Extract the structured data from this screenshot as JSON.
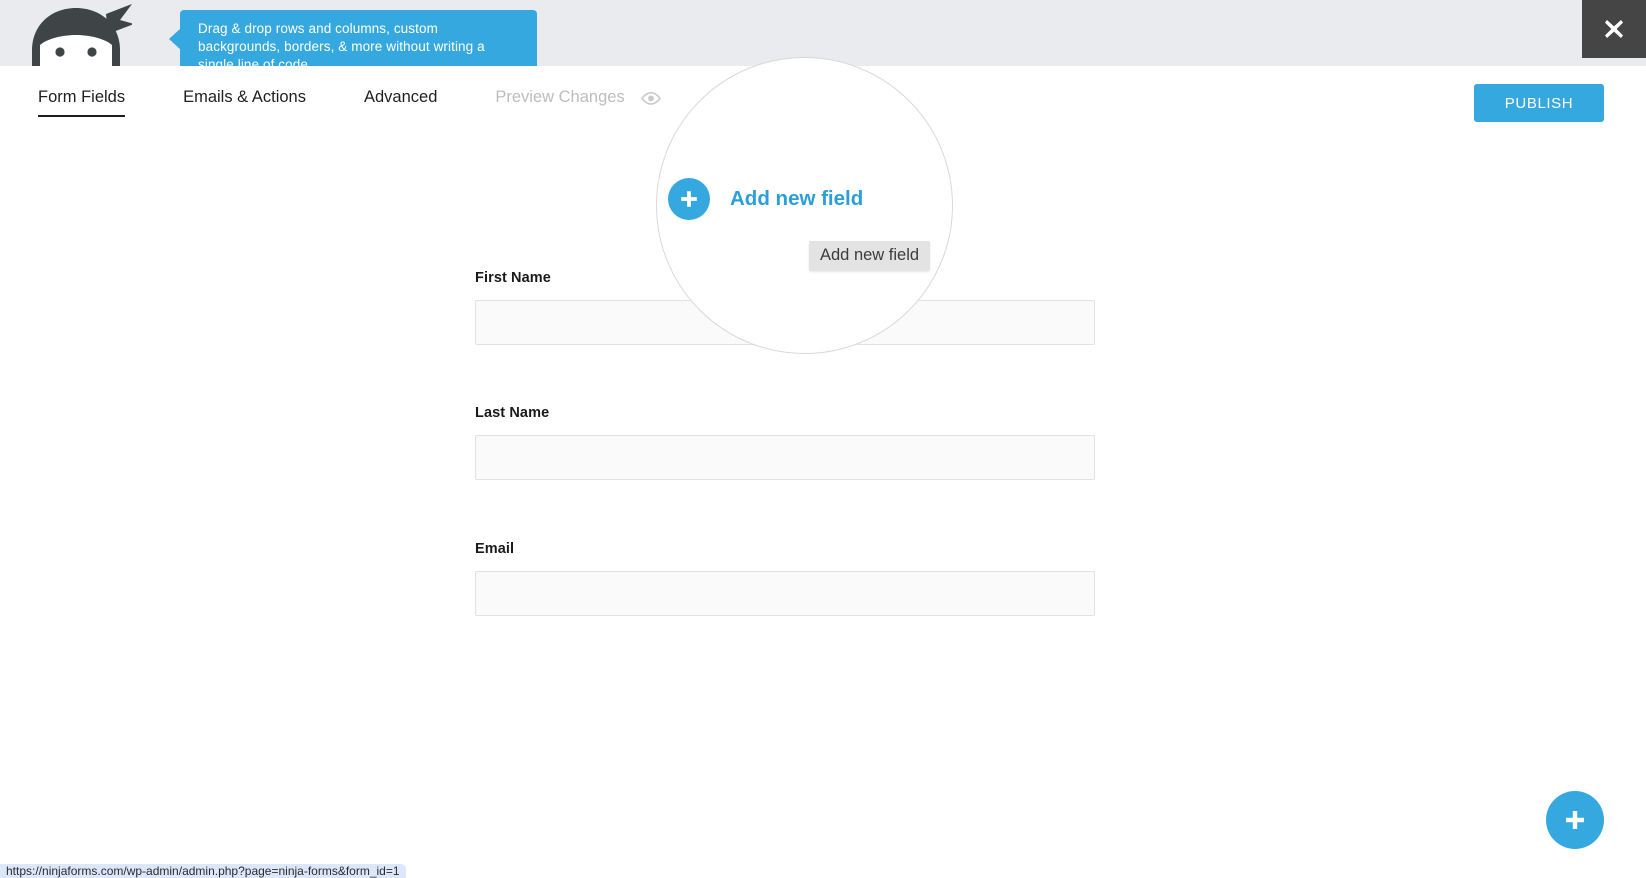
{
  "topbar": {
    "logo_icon": "ninja-forms-logo",
    "callout": {
      "text": "Drag & drop rows and columns, custom backgrounds, borders, & more without writing a single line of code."
    },
    "close_icon": "close-icon"
  },
  "tabs": [
    {
      "label": "Form Fields",
      "active": true,
      "muted": false
    },
    {
      "label": "Emails & Actions",
      "active": false,
      "muted": false
    },
    {
      "label": "Advanced",
      "active": false,
      "muted": false
    },
    {
      "label": "Preview Changes",
      "active": false,
      "muted": true,
      "icon": "eye-icon"
    }
  ],
  "actions": {
    "publish_label": "PUBLISH"
  },
  "overlay": {
    "add_new_field_label": "Add new field",
    "plus_icon": "plus-icon",
    "tooltip_text": "Add new field"
  },
  "form_fields": [
    {
      "label": "First Name",
      "value": "",
      "placeholder": ""
    },
    {
      "label": "Last Name",
      "value": "",
      "placeholder": ""
    },
    {
      "label": "Email",
      "value": "",
      "placeholder": ""
    }
  ],
  "fab": {
    "icon": "plus-icon"
  },
  "status_bar": {
    "text": "https://ninjaforms.com/wp-admin/admin.php?page=ninja-forms&form_id=1"
  },
  "colors": {
    "accent": "#36a8e0",
    "accent_text": "#2a9fdb",
    "topbar_bg": "#eaebef",
    "close_bg": "#454545",
    "tooltip_bg": "#e3e3e3",
    "input_bg": "#fafafa",
    "input_border": "#e2e2e2",
    "status_bg": "#dde7fb"
  }
}
